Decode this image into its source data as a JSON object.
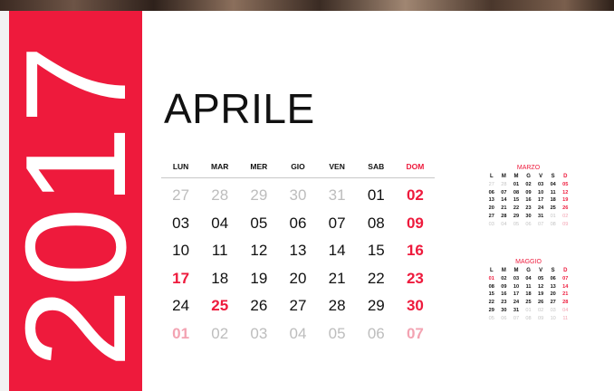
{
  "year": "2017",
  "month": {
    "title": "APRILE",
    "weekdays": [
      "LUN",
      "MAR",
      "MER",
      "GIO",
      "VEN",
      "SAB",
      "DOM"
    ],
    "weeks": [
      [
        "27",
        "28",
        "29",
        "30",
        "31",
        "01",
        "02"
      ],
      [
        "03",
        "04",
        "05",
        "06",
        "07",
        "08",
        "09"
      ],
      [
        "10",
        "11",
        "12",
        "13",
        "14",
        "15",
        "16"
      ],
      [
        "17",
        "18",
        "19",
        "20",
        "21",
        "22",
        "23"
      ],
      [
        "24",
        "25",
        "26",
        "27",
        "28",
        "29",
        "30"
      ],
      [
        "01",
        "02",
        "03",
        "04",
        "05",
        "06",
        "07"
      ]
    ],
    "out_of_month": [
      [
        0,
        0
      ],
      [
        0,
        1
      ],
      [
        0,
        2
      ],
      [
        0,
        3
      ],
      [
        0,
        4
      ],
      [
        5,
        0
      ],
      [
        5,
        1
      ],
      [
        5,
        2
      ],
      [
        5,
        3
      ],
      [
        5,
        4
      ],
      [
        5,
        5
      ],
      [
        5,
        6
      ]
    ],
    "highlighted": [
      [
        0,
        6
      ],
      [
        1,
        6
      ],
      [
        2,
        6
      ],
      [
        3,
        0
      ],
      [
        3,
        6
      ],
      [
        4,
        1
      ],
      [
        4,
        6
      ],
      [
        5,
        0
      ],
      [
        5,
        6
      ]
    ]
  },
  "mini_months": [
    {
      "title": "MARZO",
      "weekdays": [
        "L",
        "M",
        "M",
        "G",
        "V",
        "S",
        "D"
      ],
      "weeks": [
        [
          "27",
          "28",
          "01",
          "02",
          "03",
          "04",
          "05"
        ],
        [
          "06",
          "07",
          "08",
          "09",
          "10",
          "11",
          "12"
        ],
        [
          "13",
          "14",
          "15",
          "16",
          "17",
          "18",
          "19"
        ],
        [
          "20",
          "21",
          "22",
          "23",
          "24",
          "25",
          "26"
        ],
        [
          "27",
          "28",
          "29",
          "30",
          "31",
          "01",
          "02"
        ],
        [
          "03",
          "04",
          "05",
          "06",
          "07",
          "08",
          "09"
        ]
      ],
      "out_of_month": [
        [
          0,
          0
        ],
        [
          0,
          1
        ],
        [
          4,
          5
        ],
        [
          4,
          6
        ],
        [
          5,
          0
        ],
        [
          5,
          1
        ],
        [
          5,
          2
        ],
        [
          5,
          3
        ],
        [
          5,
          4
        ],
        [
          5,
          5
        ],
        [
          5,
          6
        ]
      ],
      "highlighted": [
        [
          0,
          6
        ],
        [
          1,
          6
        ],
        [
          2,
          6
        ],
        [
          3,
          6
        ],
        [
          4,
          6
        ],
        [
          5,
          6
        ]
      ]
    },
    {
      "title": "MAGGIO",
      "weekdays": [
        "L",
        "M",
        "M",
        "G",
        "V",
        "S",
        "D"
      ],
      "weeks": [
        [
          "01",
          "02",
          "03",
          "04",
          "05",
          "06",
          "07"
        ],
        [
          "08",
          "09",
          "10",
          "11",
          "12",
          "13",
          "14"
        ],
        [
          "15",
          "16",
          "17",
          "18",
          "19",
          "20",
          "21"
        ],
        [
          "22",
          "23",
          "24",
          "25",
          "26",
          "27",
          "28"
        ],
        [
          "29",
          "30",
          "31",
          "01",
          "02",
          "03",
          "04"
        ],
        [
          "05",
          "06",
          "07",
          "08",
          "09",
          "10",
          "11"
        ]
      ],
      "out_of_month": [
        [
          4,
          3
        ],
        [
          4,
          4
        ],
        [
          4,
          5
        ],
        [
          4,
          6
        ],
        [
          5,
          0
        ],
        [
          5,
          1
        ],
        [
          5,
          2
        ],
        [
          5,
          3
        ],
        [
          5,
          4
        ],
        [
          5,
          5
        ],
        [
          5,
          6
        ]
      ],
      "highlighted": [
        [
          0,
          0
        ],
        [
          0,
          6
        ],
        [
          1,
          6
        ],
        [
          2,
          6
        ],
        [
          3,
          6
        ],
        [
          4,
          6
        ],
        [
          5,
          6
        ]
      ]
    }
  ],
  "colors": {
    "accent": "#ee1a3c",
    "accent_light": "#f3a3b2",
    "muted": "#bdbdbd"
  }
}
